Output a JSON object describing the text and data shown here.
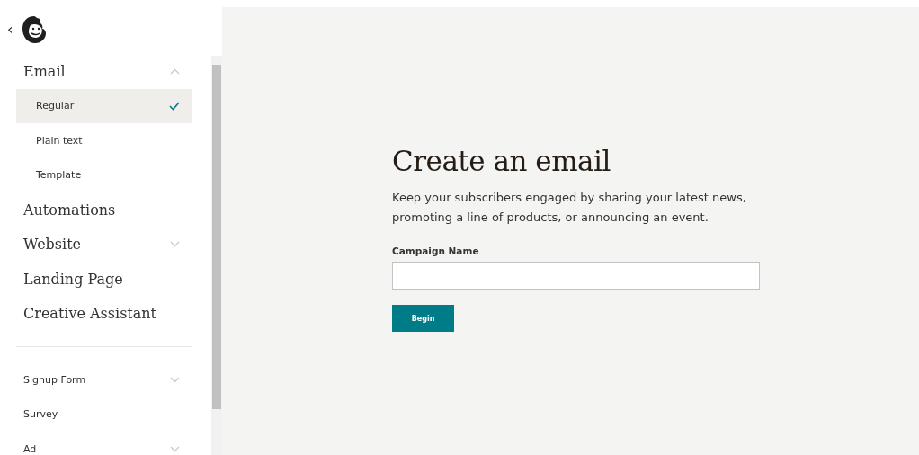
{
  "sidebar": {
    "back": "‹",
    "items": [
      {
        "kind": "heading",
        "label": "Email",
        "expanded": true
      },
      {
        "kind": "subitem",
        "label": "Regular",
        "selected": true
      },
      {
        "kind": "subitem",
        "label": "Plain text",
        "selected": false
      },
      {
        "kind": "subitem",
        "label": "Template",
        "selected": false
      },
      {
        "kind": "heading",
        "label": "Automations"
      },
      {
        "kind": "heading",
        "label": "Website",
        "expanded": false
      },
      {
        "kind": "heading",
        "label": "Landing Page"
      },
      {
        "kind": "heading",
        "label": "Creative Assistant"
      },
      {
        "kind": "divider"
      },
      {
        "kind": "minor",
        "label": "Signup Form",
        "expanded": false
      },
      {
        "kind": "minor",
        "label": "Survey"
      },
      {
        "kind": "minor",
        "label": "Ad",
        "expanded": false
      }
    ]
  },
  "main": {
    "title": "Create an email",
    "description": "Keep your subscribers engaged by sharing your latest news, promoting a line of products, or announcing an event.",
    "field_label": "Campaign Name",
    "button": "Begin"
  }
}
